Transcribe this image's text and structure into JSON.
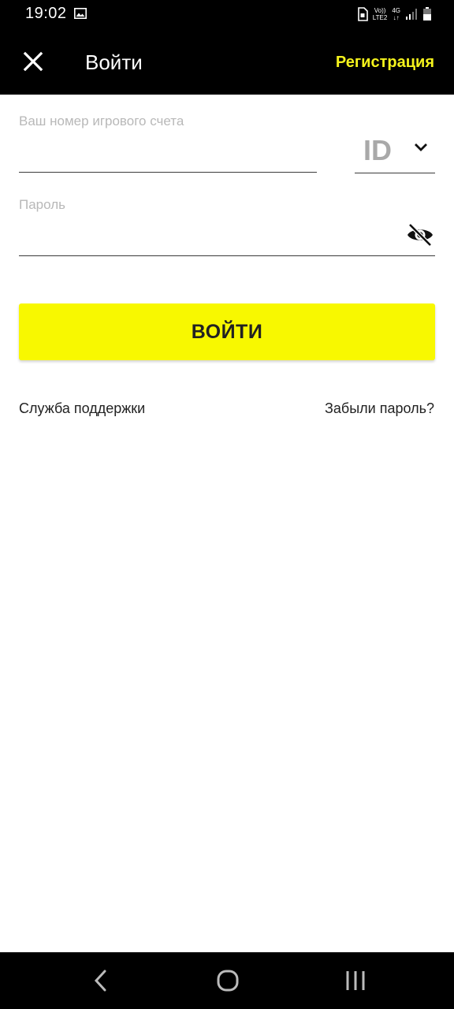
{
  "status_bar": {
    "time": "19:02",
    "network_top": "Vo))",
    "network_bottom": "LTE2",
    "data_type": "4G"
  },
  "app_bar": {
    "title": "Войти",
    "register_label": "Регистрация"
  },
  "form": {
    "account_label": "Ваш номер игрового счета",
    "account_value": "",
    "id_type": "ID",
    "password_label": "Пароль",
    "password_value": ""
  },
  "actions": {
    "login_label": "ВОЙТИ",
    "support_label": "Служба поддержки",
    "forgot_label": "Забыли пароль?"
  },
  "colors": {
    "accent": "#f8f800",
    "register_text": "#f4f21c",
    "bar_background": "#000000"
  },
  "icons": {
    "close": "close-icon",
    "chevron": "chevron-down-icon",
    "visibility": "eye-off-icon",
    "nav_back": "back-icon",
    "nav_home": "home-icon",
    "nav_recents": "recents-icon"
  }
}
